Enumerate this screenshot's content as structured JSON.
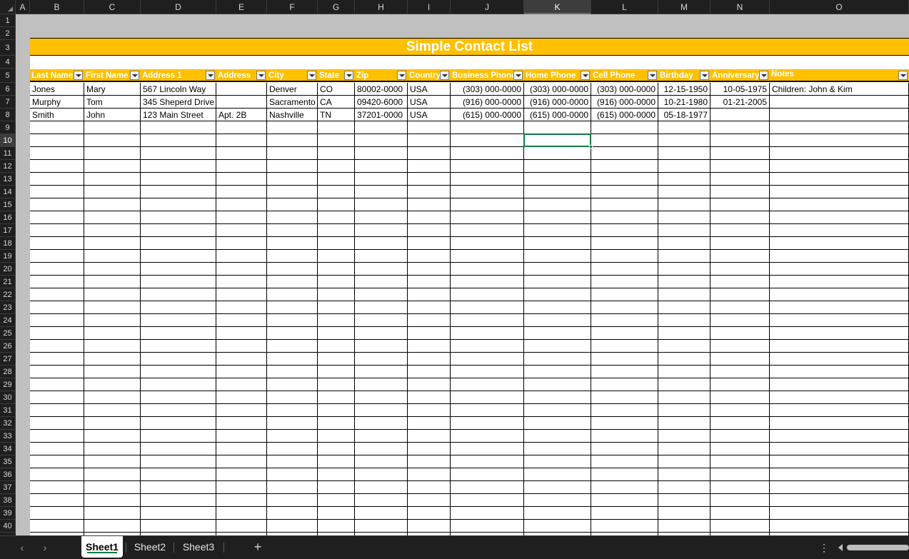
{
  "columns": [
    "A",
    "B",
    "C",
    "D",
    "E",
    "F",
    "G",
    "H",
    "I",
    "J",
    "K",
    "L",
    "M",
    "N",
    "O"
  ],
  "selected_column": "K",
  "selected_row": 10,
  "rows": [
    "1",
    "2",
    "3",
    "4",
    "5",
    "6",
    "7",
    "8",
    "9",
    "10",
    "11",
    "12",
    "13",
    "14",
    "15",
    "16",
    "17",
    "18",
    "19",
    "20",
    "21",
    "22",
    "23",
    "24",
    "25",
    "26",
    "27",
    "28",
    "29",
    "30",
    "31",
    "32",
    "33",
    "34",
    "35",
    "36",
    "37",
    "38",
    "39",
    "40"
  ],
  "title": "Simple Contact List",
  "headers": [
    "Last Name",
    "First Name",
    "Address 1",
    "Address",
    "City",
    "State",
    "Zip",
    "Country",
    "Business Phone",
    "Home Phone",
    "Cell Phone",
    "Birthday",
    "Anniversary",
    "Notes"
  ],
  "data_rows": [
    [
      "Jones",
      "Mary",
      "567 Lincoln Way",
      "",
      "Denver",
      "CO",
      "80002-0000",
      "USA",
      "(303) 000-0000",
      "(303) 000-0000",
      "(303) 000-0000",
      "12-15-1950",
      "10-05-1975",
      "Children: John & Kim"
    ],
    [
      "Murphy",
      "Tom",
      "345 Sheperd Drive",
      "",
      "Sacramento",
      "CA",
      "09420-6000",
      "USA",
      "(916) 000-0000",
      "(916) 000-0000",
      "(916) 000-0000",
      "10-21-1980",
      "01-21-2005",
      ""
    ],
    [
      "Smith",
      "John",
      "123 Main Street",
      "Apt. 2B",
      "Nashville",
      "TN",
      "37201-0000",
      "USA",
      "(615) 000-0000",
      "(615) 000-0000",
      "(615) 000-0000",
      "05-18-1977",
      "",
      ""
    ]
  ],
  "sheet_tabs": [
    "Sheet1",
    "Sheet2",
    "Sheet3"
  ],
  "active_tab": "Sheet1",
  "icons": {
    "nav_prev": "‹",
    "nav_next": "›",
    "add_sheet": "+",
    "more_options": "⋮"
  },
  "colors": {
    "accent": "#ffc000",
    "selection": "#107c41",
    "header_text": "#ffffff"
  }
}
